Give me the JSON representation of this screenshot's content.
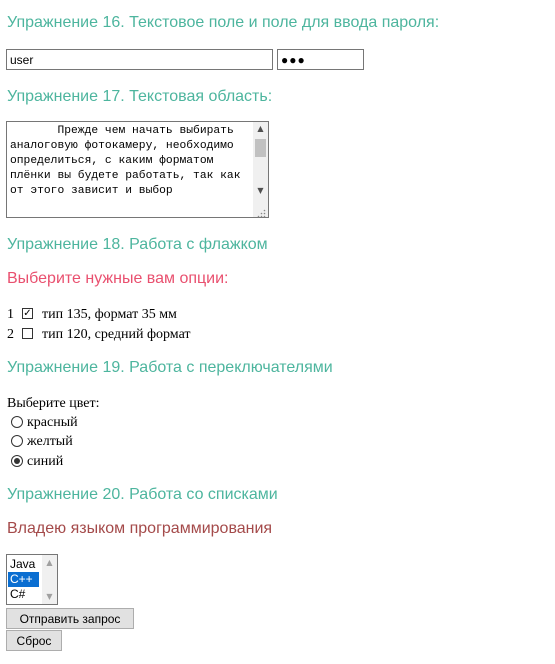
{
  "ex16": {
    "heading": "Упражнение 16. Текстовое поле и поле для ввода пароля:",
    "text_value": "user",
    "password_value": "●●●"
  },
  "ex17": {
    "heading": "Упражнение 17. Текстовая область:",
    "textarea_value": "       Прежде чем начать выбирать аналоговую фотокамеру, необходимо определиться, с каким форматом плёнки вы будете работать, так как от этого зависит и выбор"
  },
  "ex18": {
    "heading": "Упражнение 18. Работа с флажком",
    "prompt": "Выберите нужные вам опции:",
    "options": [
      {
        "number": "1",
        "label": "тип 135, формат 35 мм",
        "checked": true,
        "mark": "✓"
      },
      {
        "number": "2",
        "label": "тип 120, средний формат",
        "checked": false,
        "mark": ""
      }
    ]
  },
  "ex19": {
    "heading": "Упражнение 19. Работа с переключателями",
    "prompt": "Выберите цвет:",
    "options": [
      {
        "label": "красный",
        "selected": false
      },
      {
        "label": "желтый",
        "selected": false
      },
      {
        "label": "синий",
        "selected": true
      }
    ]
  },
  "ex20": {
    "heading": "Упражнение 20. Работа со списками",
    "prompt": "Владею языком программирования",
    "languages": [
      {
        "label": "Java",
        "selected": false
      },
      {
        "label": "C++",
        "selected": true
      },
      {
        "label": "C#",
        "selected": false
      }
    ]
  },
  "buttons": {
    "submit": "Отправить запрос",
    "reset": "Сброс"
  },
  "colors": {
    "heading": "#4db59e",
    "prompt_pink": "#e9506f",
    "prompt_maroon": "#a44a4a",
    "selection": "#0a6ed1"
  },
  "icons": {
    "scroll_up": "▲",
    "scroll_down": "▼"
  }
}
